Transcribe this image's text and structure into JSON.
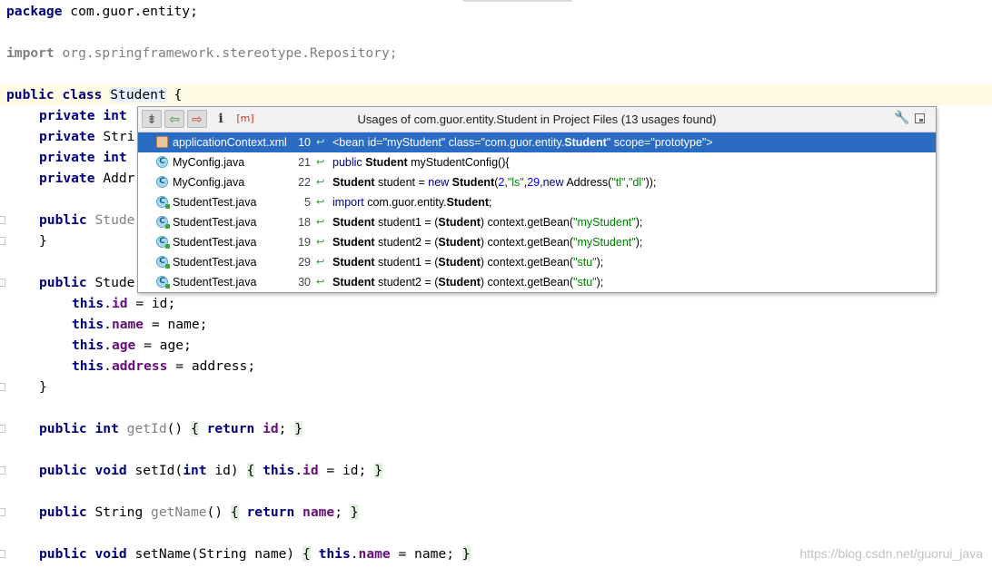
{
  "editor": {
    "lines": {
      "package_kw": "package",
      "package_name": " com.guor.entity;",
      "import_kw": "import",
      "import_name": " org.springframework.stereotype.Repository;",
      "class_pub": "public",
      "class_kw": "class",
      "class_name": "Student",
      "class_brace": " {",
      "f1_mod": "private",
      "f1_type": "int",
      "f2_mod": "private",
      "f2_type": "Stri",
      "f3_mod": "private",
      "f3_type": "int",
      "f4_mod": "private",
      "f4_type": "Addr",
      "c1_mod": "public",
      "c1_name": "Stude",
      "c1_close": "}",
      "c2_mod": "public",
      "c2_name": "Stude",
      "a1_this": "this",
      "a1_field": "id",
      "a1_rest": " = id;",
      "a2_this": "this",
      "a2_field": "name",
      "a2_rest": " = name;",
      "a3_this": "this",
      "a3_field": "age",
      "a3_rest": " = age;",
      "a4_this": "this",
      "a4_field": "address",
      "a4_rest": " = address;",
      "c2_close": "}",
      "m1_mod": "public",
      "m1_type": "int",
      "m1_name": "getId",
      "m1_paren": "()",
      "m1_open": "{",
      "m1_ret": "return",
      "m1_field": "id",
      "m1_semi": ";",
      "m1_close": "}",
      "m2_mod": "public",
      "m2_type": "void",
      "m2_name": "setId(",
      "m2_ptype": "int",
      "m2_pname": " id)",
      "m2_open": "{",
      "m2_this": "this",
      "m2_field": "id",
      "m2_rest": " = id;",
      "m2_close": "}",
      "m3_mod": "public",
      "m3_type": "String",
      "m3_name": "getName",
      "m3_paren": "()",
      "m3_open": "{",
      "m3_ret": "return",
      "m3_field": "name",
      "m3_semi": ";",
      "m3_close": "}",
      "m4_mod": "public",
      "m4_type": "void",
      "m4_name": "setName(String name)",
      "m4_open": "{",
      "m4_this": "this",
      "m4_field": "name",
      "m4_rest": " = name;",
      "m4_close": "}"
    }
  },
  "popup": {
    "title": "Usages of com.guor.entity.Student in Project Files (13 usages found)",
    "toolbar": {
      "merge_icon": "merge-lines-icon",
      "prev_icon": "previous-usage-icon",
      "next_icon": "next-usage-icon",
      "info_icon": "info-icon",
      "member_icon": "member-filter-icon",
      "member_label": "m",
      "info_label": "i",
      "settings_icon": "wrench-icon",
      "pin_icon": "open-in-window-icon"
    },
    "rows": [
      {
        "file": "applicationContext.xml",
        "line": "10",
        "icon": "xml-file-icon",
        "pre": "<bean id=\"myStudent\" class=\"com.guor.entity.",
        "bold": "Student",
        "post": "\" scope=\"prototype\">"
      },
      {
        "file": "MyConfig.java",
        "line": "21",
        "icon": "java-class-icon",
        "kw": "public ",
        "bold": "Student",
        "post": " myStudentConfig(){"
      },
      {
        "file": "MyConfig.java",
        "line": "22",
        "icon": "java-class-icon",
        "bold": "Student",
        "mid": " student = ",
        "kw": "new ",
        "bold2": "Student",
        "args_open": "(",
        "n1": "2",
        "c1": ",",
        "s1": "\"ls\"",
        "c2": ",",
        "n2": "29",
        "c3": ",",
        "kw2": "new ",
        "tail1": "Address(",
        "s2": "\"tl\"",
        "c4": ",",
        "s3": "\"dl\"",
        "tail2": "));"
      },
      {
        "file": "StudentTest.java",
        "line": "5",
        "icon": "java-test-icon",
        "kw": "import ",
        "pre": "com.guor.entity.",
        "bold": "Student",
        "post": ";"
      },
      {
        "file": "StudentTest.java",
        "line": "18",
        "icon": "java-test-icon",
        "bold": "Student",
        "mid": " student1 = (",
        "bold2": "Student",
        "post": ") context.getBean(",
        "str": "\"myStudent\"",
        "end": ");"
      },
      {
        "file": "StudentTest.java",
        "line": "19",
        "icon": "java-test-icon",
        "bold": "Student",
        "mid": " student2 = (",
        "bold2": "Student",
        "post": ") context.getBean(",
        "str": "\"myStudent\"",
        "end": ");"
      },
      {
        "file": "StudentTest.java",
        "line": "29",
        "icon": "java-test-icon",
        "bold": "Student",
        "mid": " student1 = (",
        "bold2": "Student",
        "post": ") context.getBean(",
        "str": "\"stu\"",
        "end": ");"
      },
      {
        "file": "StudentTest.java",
        "line": "30",
        "icon": "java-test-icon",
        "bold": "Student",
        "mid": " student2 = (",
        "bold2": "Student",
        "post": ") context.getBean(",
        "str": "\"stu\"",
        "end": ");"
      }
    ],
    "usage_arrow": "↩"
  },
  "watermark": "https://blog.csdn.net/guorui_java",
  "colors": {
    "keyword": "#000080",
    "field": "#660e7a",
    "selection": "#2a6cc4",
    "string": "#008000",
    "number": "#0000ff"
  }
}
